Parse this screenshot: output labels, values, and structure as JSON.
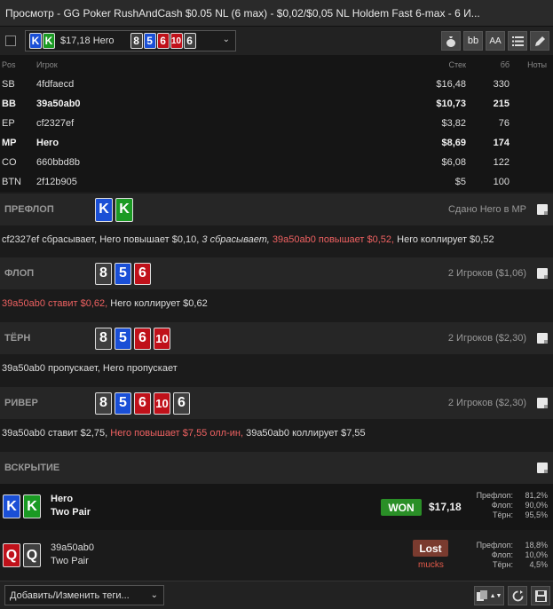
{
  "window": {
    "title": "Просмотр - GG Poker RushAndCash $0.05 NL (6 max) - $0,02/$0,05 NL Holdem Fast 6-max  - 6 И..."
  },
  "hand_selector": {
    "amount": "$17,18 Hero",
    "chevron": "⌄"
  },
  "toolbar": {
    "bb_label": "bb",
    "font_label": "AA",
    "icons": [
      "money-bag-icon",
      "font-size-icon",
      "list-icon",
      "pencil-icon"
    ]
  },
  "players": {
    "headers": {
      "pos": "Pos",
      "name": "Игрок",
      "stack": "Стек",
      "bb": "бб",
      "notes": "Ноты"
    },
    "rows": [
      {
        "pos": "SB",
        "name": "4fdfaecd",
        "stack": "$16,48",
        "bb": "330",
        "bold": false
      },
      {
        "pos": "BB",
        "name": "39a50ab0",
        "stack": "$10,73",
        "bb": "215",
        "bold": true
      },
      {
        "pos": "EP",
        "name": "cf2327ef",
        "stack": "$3,82",
        "bb": "76",
        "bold": false
      },
      {
        "pos": "MP",
        "name": "Hero",
        "stack": "$8,69",
        "bb": "174",
        "bold": true
      },
      {
        "pos": "CO",
        "name": "660bbd8b",
        "stack": "$6,08",
        "bb": "122",
        "bold": false
      },
      {
        "pos": "BTN",
        "name": "2f12b905",
        "stack": "$5",
        "bb": "100",
        "bold": false
      }
    ]
  },
  "cards": {
    "hole_hero": [
      {
        "rank": "K",
        "suit": "blue"
      },
      {
        "rank": "K",
        "suit": "green"
      }
    ],
    "flop": [
      {
        "rank": "8",
        "suit": "gray"
      },
      {
        "rank": "5",
        "suit": "blue"
      },
      {
        "rank": "6",
        "suit": "red"
      }
    ],
    "turn": {
      "rank": "10",
      "suit": "red"
    },
    "river": {
      "rank": "6",
      "suit": "gray"
    },
    "hole_villain": [
      {
        "rank": "Q",
        "suit": "red"
      },
      {
        "rank": "Q",
        "suit": "gray"
      }
    ]
  },
  "streets": {
    "preflop": {
      "name": "ПРЕФЛОП",
      "info": "Сдано Hero в MP"
    },
    "flop": {
      "name": "ФЛОП",
      "info": "2 Игроков ($1,06)"
    },
    "turn": {
      "name": "ТЁРН",
      "info": "2 Игроков ($2,30)"
    },
    "river": {
      "name": "РИВЕР",
      "info": "2 Игроков ($2,30)"
    },
    "showdown": {
      "name": "ВСКРЫТИЕ"
    }
  },
  "actions": {
    "preflop": {
      "a1": "cf2327ef сбрасывает, ",
      "a2": "Hero повышает $0,10, ",
      "a3": "3 сбрасывает, ",
      "a4": "39a50ab0 повышает $0,52, ",
      "a5": "Hero коллирует $0,52"
    },
    "flop": {
      "a1": "39a50ab0 ставит $0,62, ",
      "a2": "Hero коллирует $0,62"
    },
    "turn": {
      "a1": "39a50ab0 пропускает, Hero пропускает"
    },
    "river": {
      "a1": "39a50ab0 ставит $2,75, ",
      "a2": "Hero повышает $7,55 олл-ин, ",
      "a3": "39a50ab0 коллирует $7,55"
    }
  },
  "showdown": {
    "hero": {
      "name": "Hero",
      "hand": "Two Pair",
      "result": "WON",
      "amount": "$17,18",
      "equity": [
        {
          "label": "Префлоп:",
          "value": "81,2%"
        },
        {
          "label": "Флоп:",
          "value": "90,0%"
        },
        {
          "label": "Тёрн:",
          "value": "95,5%"
        }
      ]
    },
    "villain": {
      "name": "39a50ab0",
      "hand": "Two Pair",
      "result": "Lost",
      "muck": "mucks",
      "equity": [
        {
          "label": "Префлоп:",
          "value": "18,8%"
        },
        {
          "label": "Флоп:",
          "value": "10,0%"
        },
        {
          "label": "Тёрн:",
          "value": "4,5%"
        }
      ]
    }
  },
  "footer": {
    "tag_label": "Добавить/Изменить теги...",
    "chevron": "⌄",
    "stepper": "▲▼"
  },
  "colors": {
    "blue": "#1a4fd6",
    "green": "#1a9a23",
    "red": "#c0111a",
    "gray": "#3f3f3f",
    "won": "#2a8f27",
    "lost": "#7a3b2f",
    "action_red": "#ee6161"
  }
}
